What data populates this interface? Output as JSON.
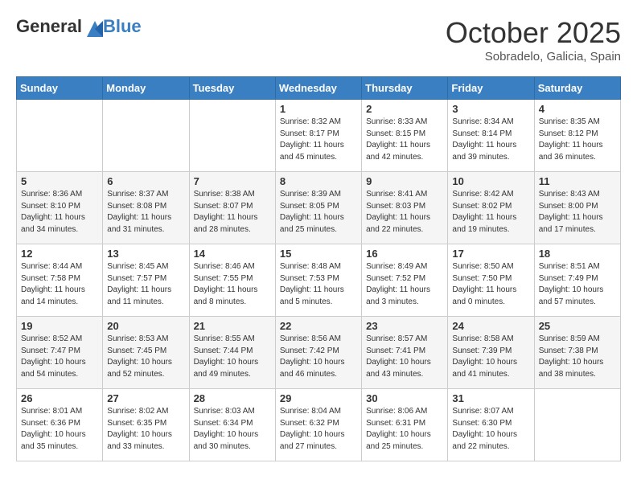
{
  "header": {
    "logo_general": "General",
    "logo_blue": "Blue",
    "month": "October 2025",
    "location": "Sobradelo, Galicia, Spain"
  },
  "days_of_week": [
    "Sunday",
    "Monday",
    "Tuesday",
    "Wednesday",
    "Thursday",
    "Friday",
    "Saturday"
  ],
  "weeks": [
    [
      {
        "day": "",
        "info": ""
      },
      {
        "day": "",
        "info": ""
      },
      {
        "day": "",
        "info": ""
      },
      {
        "day": "1",
        "info": "Sunrise: 8:32 AM\nSunset: 8:17 PM\nDaylight: 11 hours\nand 45 minutes."
      },
      {
        "day": "2",
        "info": "Sunrise: 8:33 AM\nSunset: 8:15 PM\nDaylight: 11 hours\nand 42 minutes."
      },
      {
        "day": "3",
        "info": "Sunrise: 8:34 AM\nSunset: 8:14 PM\nDaylight: 11 hours\nand 39 minutes."
      },
      {
        "day": "4",
        "info": "Sunrise: 8:35 AM\nSunset: 8:12 PM\nDaylight: 11 hours\nand 36 minutes."
      }
    ],
    [
      {
        "day": "5",
        "info": "Sunrise: 8:36 AM\nSunset: 8:10 PM\nDaylight: 11 hours\nand 34 minutes."
      },
      {
        "day": "6",
        "info": "Sunrise: 8:37 AM\nSunset: 8:08 PM\nDaylight: 11 hours\nand 31 minutes."
      },
      {
        "day": "7",
        "info": "Sunrise: 8:38 AM\nSunset: 8:07 PM\nDaylight: 11 hours\nand 28 minutes."
      },
      {
        "day": "8",
        "info": "Sunrise: 8:39 AM\nSunset: 8:05 PM\nDaylight: 11 hours\nand 25 minutes."
      },
      {
        "day": "9",
        "info": "Sunrise: 8:41 AM\nSunset: 8:03 PM\nDaylight: 11 hours\nand 22 minutes."
      },
      {
        "day": "10",
        "info": "Sunrise: 8:42 AM\nSunset: 8:02 PM\nDaylight: 11 hours\nand 19 minutes."
      },
      {
        "day": "11",
        "info": "Sunrise: 8:43 AM\nSunset: 8:00 PM\nDaylight: 11 hours\nand 17 minutes."
      }
    ],
    [
      {
        "day": "12",
        "info": "Sunrise: 8:44 AM\nSunset: 7:58 PM\nDaylight: 11 hours\nand 14 minutes."
      },
      {
        "day": "13",
        "info": "Sunrise: 8:45 AM\nSunset: 7:57 PM\nDaylight: 11 hours\nand 11 minutes."
      },
      {
        "day": "14",
        "info": "Sunrise: 8:46 AM\nSunset: 7:55 PM\nDaylight: 11 hours\nand 8 minutes."
      },
      {
        "day": "15",
        "info": "Sunrise: 8:48 AM\nSunset: 7:53 PM\nDaylight: 11 hours\nand 5 minutes."
      },
      {
        "day": "16",
        "info": "Sunrise: 8:49 AM\nSunset: 7:52 PM\nDaylight: 11 hours\nand 3 minutes."
      },
      {
        "day": "17",
        "info": "Sunrise: 8:50 AM\nSunset: 7:50 PM\nDaylight: 11 hours\nand 0 minutes."
      },
      {
        "day": "18",
        "info": "Sunrise: 8:51 AM\nSunset: 7:49 PM\nDaylight: 10 hours\nand 57 minutes."
      }
    ],
    [
      {
        "day": "19",
        "info": "Sunrise: 8:52 AM\nSunset: 7:47 PM\nDaylight: 10 hours\nand 54 minutes."
      },
      {
        "day": "20",
        "info": "Sunrise: 8:53 AM\nSunset: 7:45 PM\nDaylight: 10 hours\nand 52 minutes."
      },
      {
        "day": "21",
        "info": "Sunrise: 8:55 AM\nSunset: 7:44 PM\nDaylight: 10 hours\nand 49 minutes."
      },
      {
        "day": "22",
        "info": "Sunrise: 8:56 AM\nSunset: 7:42 PM\nDaylight: 10 hours\nand 46 minutes."
      },
      {
        "day": "23",
        "info": "Sunrise: 8:57 AM\nSunset: 7:41 PM\nDaylight: 10 hours\nand 43 minutes."
      },
      {
        "day": "24",
        "info": "Sunrise: 8:58 AM\nSunset: 7:39 PM\nDaylight: 10 hours\nand 41 minutes."
      },
      {
        "day": "25",
        "info": "Sunrise: 8:59 AM\nSunset: 7:38 PM\nDaylight: 10 hours\nand 38 minutes."
      }
    ],
    [
      {
        "day": "26",
        "info": "Sunrise: 8:01 AM\nSunset: 6:36 PM\nDaylight: 10 hours\nand 35 minutes."
      },
      {
        "day": "27",
        "info": "Sunrise: 8:02 AM\nSunset: 6:35 PM\nDaylight: 10 hours\nand 33 minutes."
      },
      {
        "day": "28",
        "info": "Sunrise: 8:03 AM\nSunset: 6:34 PM\nDaylight: 10 hours\nand 30 minutes."
      },
      {
        "day": "29",
        "info": "Sunrise: 8:04 AM\nSunset: 6:32 PM\nDaylight: 10 hours\nand 27 minutes."
      },
      {
        "day": "30",
        "info": "Sunrise: 8:06 AM\nSunset: 6:31 PM\nDaylight: 10 hours\nand 25 minutes."
      },
      {
        "day": "31",
        "info": "Sunrise: 8:07 AM\nSunset: 6:30 PM\nDaylight: 10 hours\nand 22 minutes."
      },
      {
        "day": "",
        "info": ""
      }
    ]
  ]
}
